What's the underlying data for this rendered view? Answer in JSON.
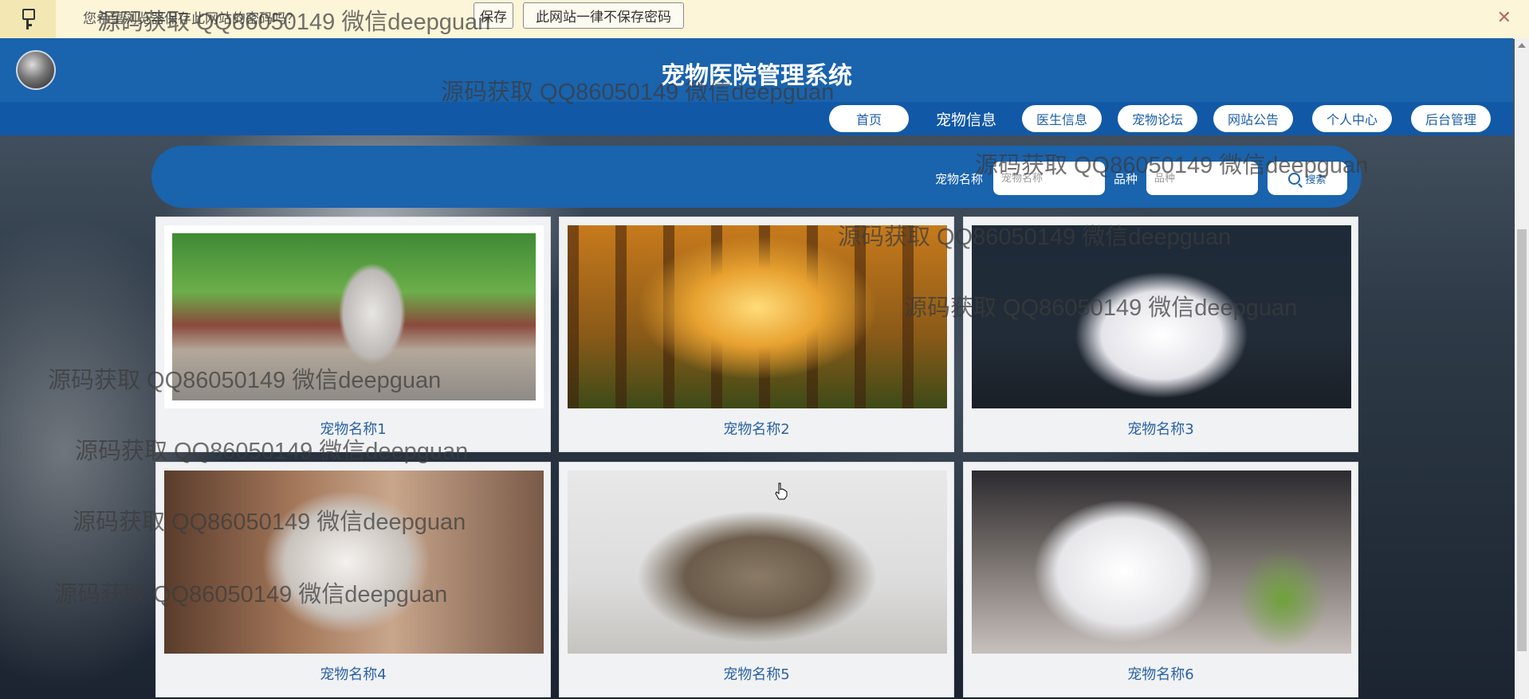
{
  "password_bar": {
    "prompt": "您希望浏览器保存此网站的密码吗？",
    "save_label": "保存",
    "never_label": "此网站一律不保存密码",
    "close": "✕"
  },
  "header": {
    "title": "宠物医院管理系统"
  },
  "nav": {
    "home": "首页",
    "pet_info": "宠物信息",
    "doctor_info": "医生信息",
    "pet_forum": "宠物论坛",
    "announcement": "网站公告",
    "personal_center": "个人中心",
    "admin": "后台管理"
  },
  "search": {
    "name_label": "宠物名称",
    "name_placeholder": "宠物名称",
    "breed_label": "品种",
    "breed_placeholder": "品种",
    "button_label": "搜索"
  },
  "pets": [
    {
      "name": "宠物名称1"
    },
    {
      "name": "宠物名称2"
    },
    {
      "name": "宠物名称3"
    },
    {
      "name": "宠物名称4"
    },
    {
      "name": "宠物名称5"
    },
    {
      "name": "宠物名称6"
    }
  ],
  "watermark": "源码获取 QQ86050149 微信deepguan"
}
